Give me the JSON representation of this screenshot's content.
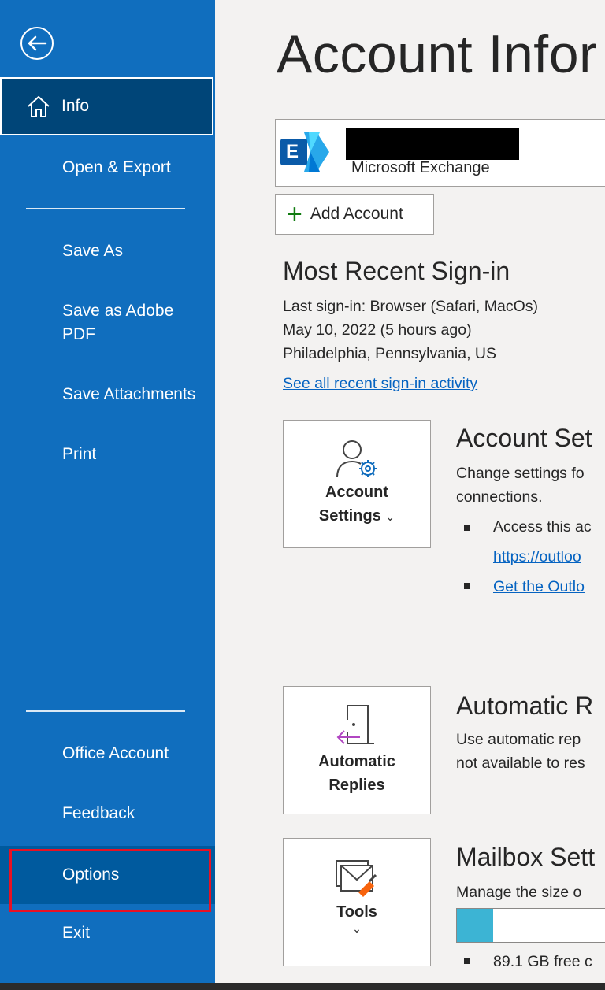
{
  "sidebar": {
    "items": [
      {
        "label": "Info"
      },
      {
        "label": "Open & Export"
      },
      {
        "label": "Save As"
      },
      {
        "label": "Save as Adobe PDF"
      },
      {
        "label": "Save Attachments"
      },
      {
        "label": "Print"
      },
      {
        "label": "Office Account"
      },
      {
        "label": "Feedback"
      },
      {
        "label": "Options"
      },
      {
        "label": "Exit"
      }
    ],
    "save_pdf_line1": "Save as Adobe",
    "save_pdf_line2": "PDF"
  },
  "main": {
    "title": "Account Infor",
    "account": {
      "type": "Microsoft Exchange",
      "logo_letter": "E"
    },
    "add_account": "Add Account",
    "sign_in": {
      "heading": "Most Recent Sign-in",
      "lines": [
        "Last sign-in: Browser (Safari, MacOs)",
        "May 10, 2022 (5 hours ago)",
        "Philadelphia, Pennsylvania, US"
      ],
      "link": "See all recent sign-in activity"
    },
    "account_settings": {
      "tile_line1": "Account",
      "tile_line2": "Settings",
      "heading": "Account Set",
      "desc1": "Change settings fo",
      "desc2": "connections.",
      "bullet1": "Access this ac",
      "bullet1_link": "https://outloo",
      "bullet2_link": "Get the Outlo"
    },
    "auto_replies": {
      "tile_line1": "Automatic",
      "tile_line2": "Replies",
      "heading": "Automatic R",
      "desc1": "Use automatic rep",
      "desc2": "not available to res"
    },
    "mailbox": {
      "tile_label": "Tools",
      "heading": "Mailbox Sett",
      "desc": "Manage the size o",
      "quota_used_fraction": 0.2,
      "free_text": "89.1 GB free c"
    }
  },
  "colors": {
    "sidebar": "#106ebe",
    "sidebar_active": "#004578",
    "options_bg": "#005a9e",
    "highlight_box": "#e81123",
    "link": "#0563c1",
    "quota_fill": "#3cb4d4"
  }
}
